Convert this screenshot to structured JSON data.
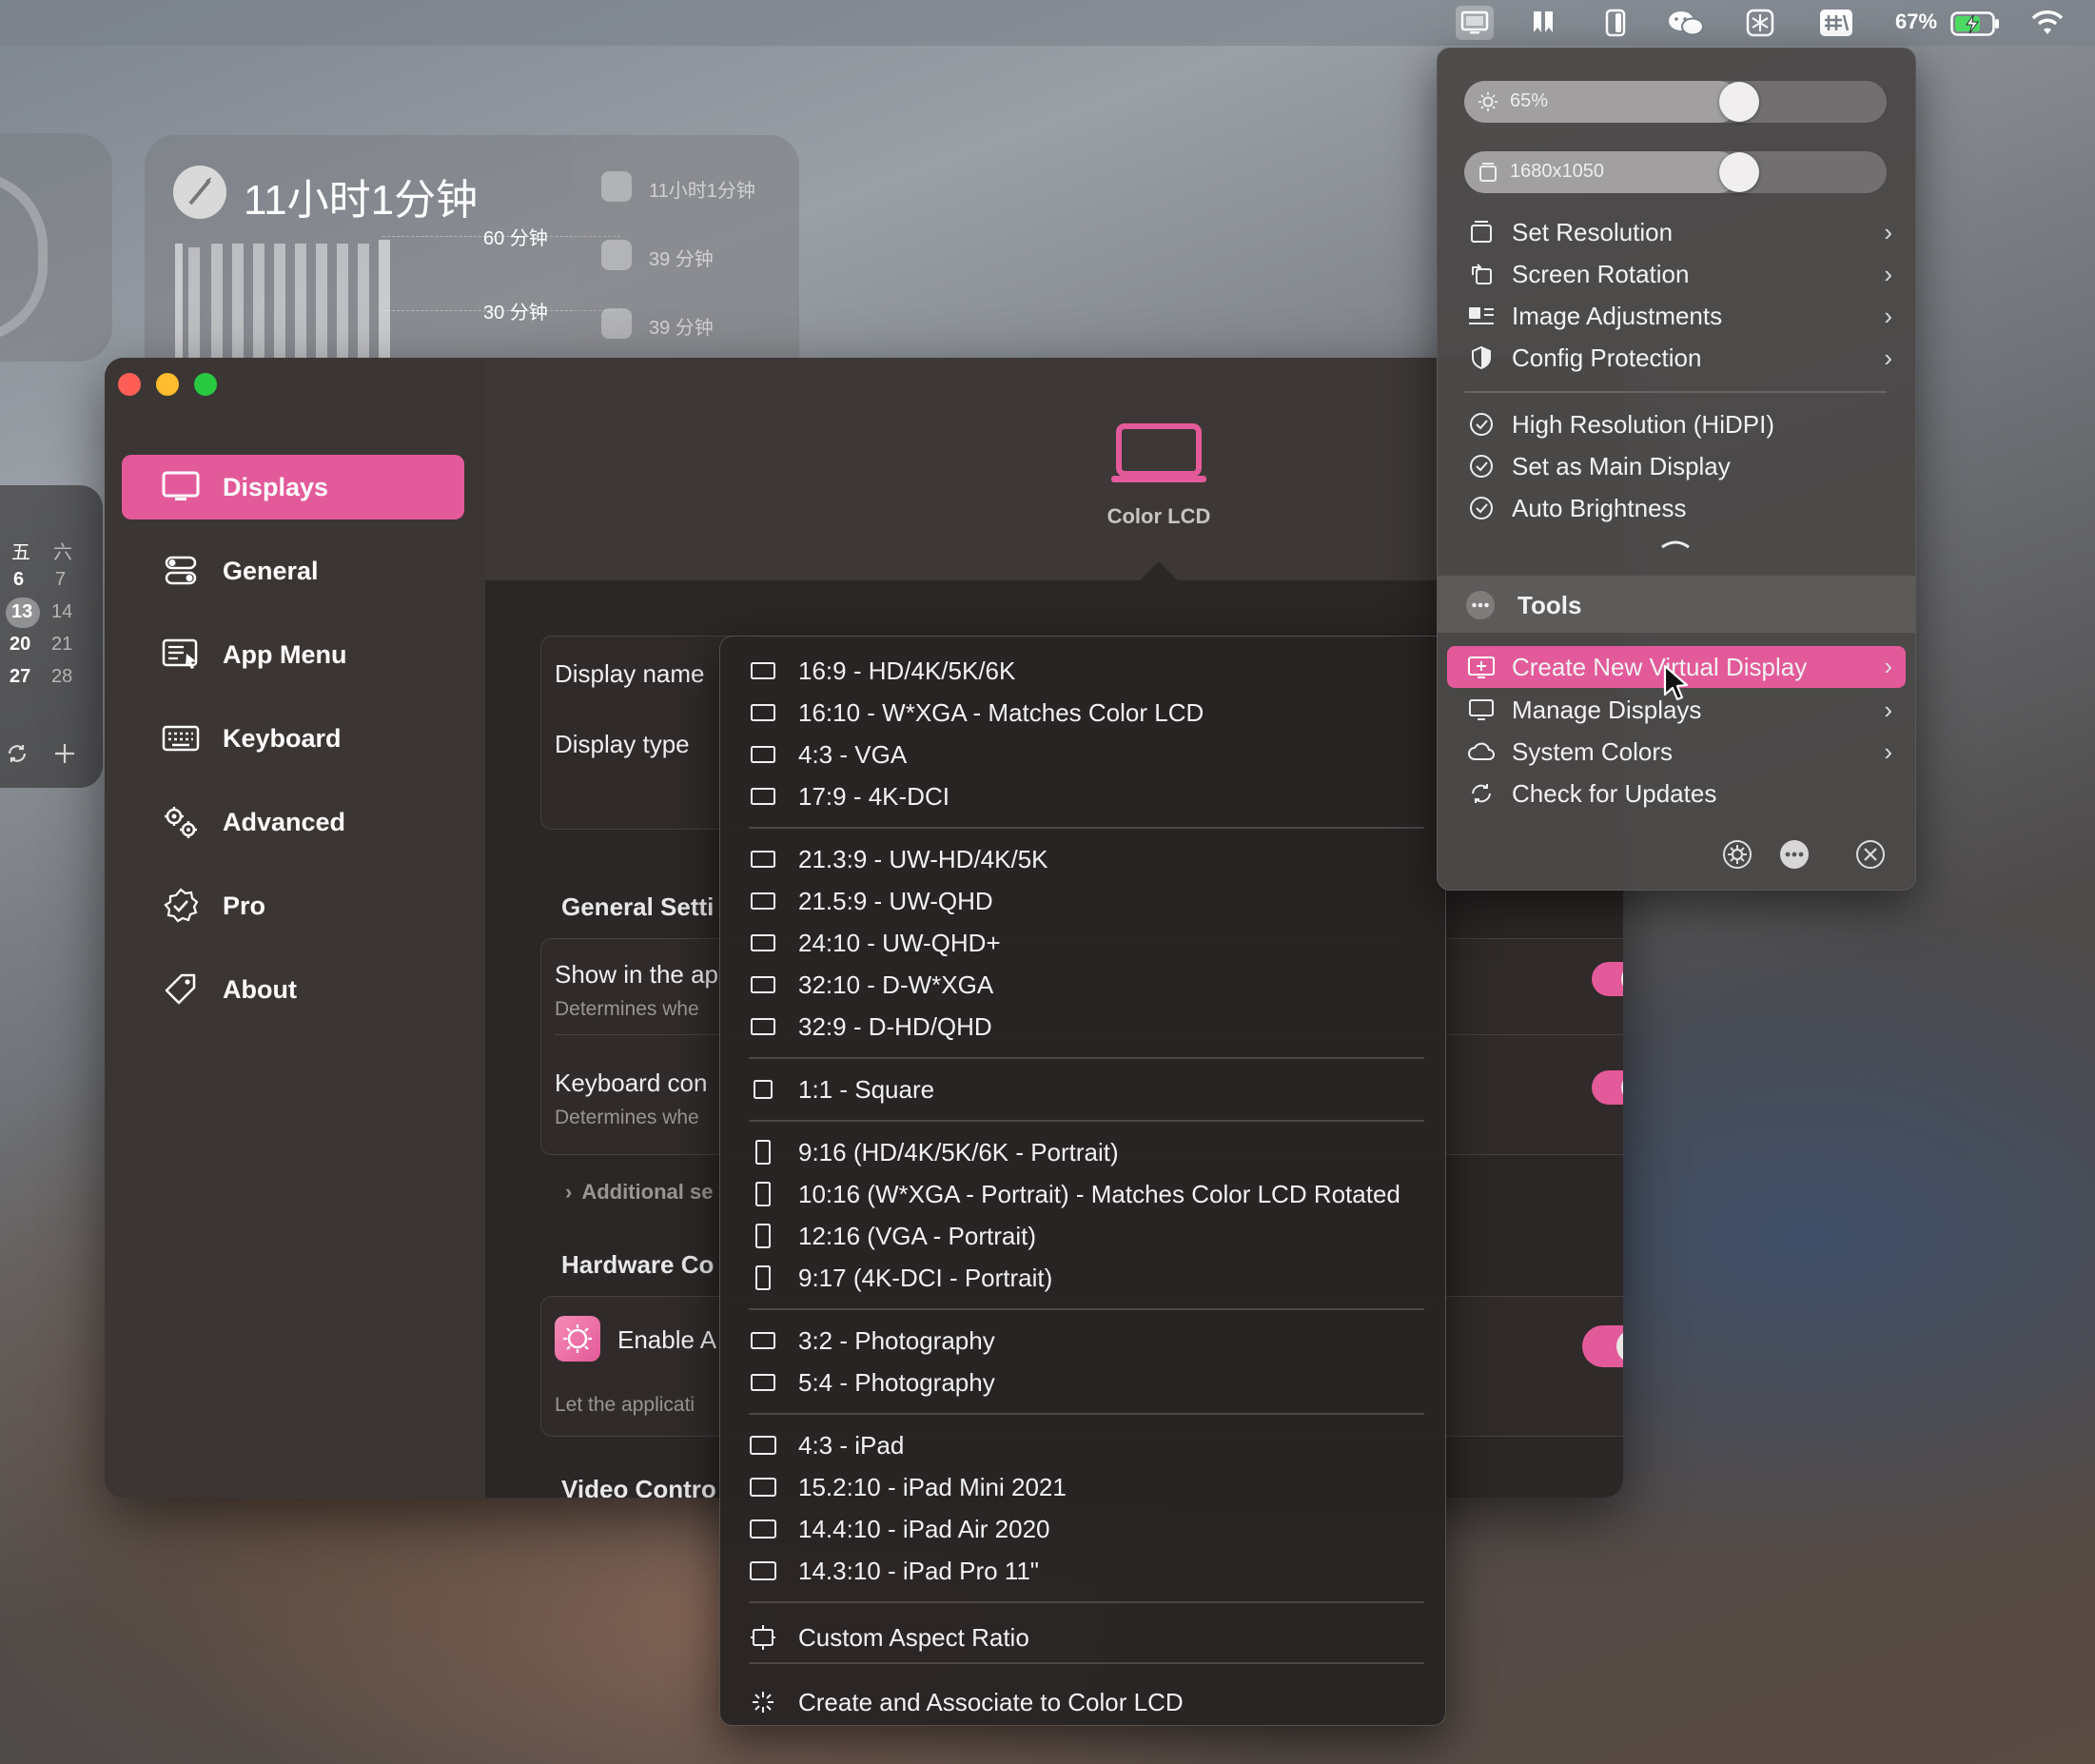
{
  "menubar": {
    "battery_percent": "67%",
    "icons": [
      "display-icon",
      "bookmark-icon",
      "phone-icon",
      "wechat-icon",
      "snowflake-icon",
      "input-method-icon",
      "battery-icon",
      "wifi-icon"
    ]
  },
  "screen_time_widget": {
    "title": "11小时1分钟",
    "gridline_top": "60 分钟",
    "gridline_mid": "30 分钟",
    "apps": [
      {
        "time": "11小时1分钟"
      },
      {
        "time": "39 分钟"
      },
      {
        "time": "39 分钟"
      }
    ]
  },
  "calendar_widget": {
    "rows": [
      [
        "五",
        "六"
      ],
      [
        "6",
        "7"
      ],
      [
        "13",
        "14"
      ],
      [
        "20",
        "21"
      ],
      [
        "27",
        "28"
      ]
    ],
    "today": "13"
  },
  "sidebar": {
    "items": [
      {
        "label": "Displays",
        "icon": "monitor-icon",
        "active": true
      },
      {
        "label": "General",
        "icon": "toggles-icon"
      },
      {
        "label": "App Menu",
        "icon": "app-menu-icon"
      },
      {
        "label": "Keyboard",
        "icon": "keyboard-icon"
      },
      {
        "label": "Advanced",
        "icon": "gears-icon"
      },
      {
        "label": "Pro",
        "icon": "badge-check-icon"
      },
      {
        "label": "About",
        "icon": "tag-icon"
      }
    ]
  },
  "content": {
    "display_label": "Color LCD",
    "display_name_label": "Display name",
    "display_type_label": "Display type",
    "general_settings_title": "General Setti",
    "show_in_app_label": "Show in the ap",
    "show_in_app_desc": "Determines whe",
    "keyboard_control_label": "Keyboard con",
    "keyboard_control_desc": "Determines whe",
    "additional_settings": "Additional se",
    "hardware_title": "Hardware Co",
    "enable_label": "Enable A",
    "enable_desc": "Let the applicati",
    "video_title": "Video Contro",
    "accent": "#e35a9a"
  },
  "submenu": {
    "groups": [
      [
        "16:9 - HD/4K/5K/6K",
        "16:10 - W*XGA - Matches Color LCD",
        "4:3 - VGA",
        "17:9 - 4K-DCI"
      ],
      [
        "21.3:9 - UW-HD/4K/5K",
        "21.5:9 - UW-QHD",
        "24:10 - UW-QHD+",
        "32:10 - D-W*XGA",
        "32:9 - D-HD/QHD"
      ],
      [
        "1:1 - Square"
      ],
      [
        "9:16 (HD/4K/5K/6K - Portrait)",
        "10:16 (W*XGA - Portrait) - Matches Color LCD Rotated",
        "12:16 (VGA - Portrait)",
        "9:17 (4K-DCI - Portrait)"
      ],
      [
        "3:2 - Photography",
        "5:4 - Photography"
      ],
      [
        "4:3 - iPad",
        "15.2:10 - iPad Mini 2021",
        "14.4:10 - iPad Air 2020",
        "14.3:10 - iPad Pro 11\""
      ]
    ],
    "custom": "Custom Aspect Ratio",
    "associate": "Create and Associate to Color LCD"
  },
  "status_menu": {
    "brightness": {
      "label": "65%",
      "value": 0.65
    },
    "resolution": {
      "label": "1680x1050",
      "value": 0.65
    },
    "items": [
      {
        "label": "Set Resolution",
        "icon": "resolution-icon",
        "submenu": true
      },
      {
        "label": "Screen Rotation",
        "icon": "rotation-icon",
        "submenu": true
      },
      {
        "label": "Image Adjustments",
        "icon": "image-adjust-icon",
        "submenu": true
      },
      {
        "label": "Config Protection",
        "icon": "shield-icon",
        "submenu": true
      }
    ],
    "checks": [
      {
        "label": "High Resolution (HiDPI)"
      },
      {
        "label": "Set as Main Display"
      },
      {
        "label": "Auto Brightness"
      }
    ],
    "tools_title": "Tools",
    "tools": [
      {
        "label": "Create New Virtual Display",
        "icon": "add-display-icon",
        "highlighted": true
      },
      {
        "label": "Manage Displays",
        "icon": "monitor-icon"
      },
      {
        "label": "System Colors",
        "icon": "cloud-icon"
      },
      {
        "label": "Check for Updates",
        "icon": "refresh-icon"
      }
    ],
    "footer_icons": [
      "settings-gear-icon",
      "more-icon",
      "close-icon"
    ]
  }
}
